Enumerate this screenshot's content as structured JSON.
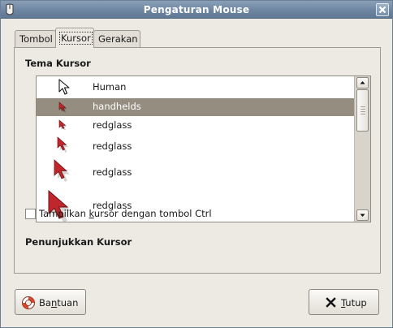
{
  "window": {
    "title": "Pengaturan Mouse"
  },
  "tabs": [
    {
      "label": "Tombol"
    },
    {
      "label": "Kursor",
      "active": true
    },
    {
      "label": "Gerakan"
    }
  ],
  "cursor_theme": {
    "heading": "Tema Kursor",
    "items": [
      {
        "label": "Human",
        "icon": "white-arrow-cursor-icon"
      },
      {
        "label": "handhelds",
        "icon": "small-red-arrow-cursor-icon",
        "selected": true
      },
      {
        "label": "redglass",
        "icon": "red-arrow-cursor-icon"
      },
      {
        "label": "redglass",
        "icon": "red-arrow-cursor-icon"
      },
      {
        "label": "redglass",
        "icon": "red-arrow-cursor-icon"
      },
      {
        "label": "redglass",
        "icon": "red-arrow-cursor-icon"
      }
    ]
  },
  "pointer_locate": {
    "heading": "Penunjukkan Kursor",
    "checkbox_pre": "Tampilkan ",
    "checkbox_mnemonic": "k",
    "checkbox_post": "ursor dengan tombol Ctrl",
    "checked": false
  },
  "buttons": {
    "help_pre": "Ba",
    "help_mnemonic": "n",
    "help_post": "tuan",
    "close_mnemonic": "T",
    "close_post": "utup"
  },
  "colors": {
    "titlebar": "#6e86a2",
    "selection": "#948d80",
    "cursor_red": "#c0262b"
  }
}
